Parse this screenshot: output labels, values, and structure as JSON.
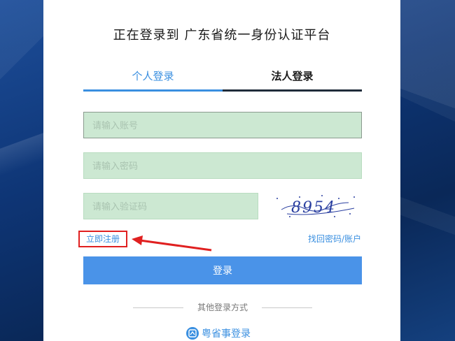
{
  "title": "正在登录到 广东省统一身份认证平台",
  "tabs": [
    {
      "label": "个人登录",
      "active": true
    },
    {
      "label": "法人登录",
      "active": false
    }
  ],
  "form": {
    "account_placeholder": "请输入账号",
    "password_placeholder": "请输入密码",
    "captcha_placeholder": "请输入验证码",
    "captcha_text": "8954",
    "register_label": "立即注册",
    "forgot_label": "找回密码/账户",
    "login_label": "登录"
  },
  "other_login": {
    "divider_label": "其他登录方式",
    "yss_label": "粤省事登录"
  },
  "colors": {
    "accent": "#3a8fe0",
    "login_button": "#4a93e8",
    "field_fill": "#cce8d2",
    "highlight": "#e02020"
  }
}
